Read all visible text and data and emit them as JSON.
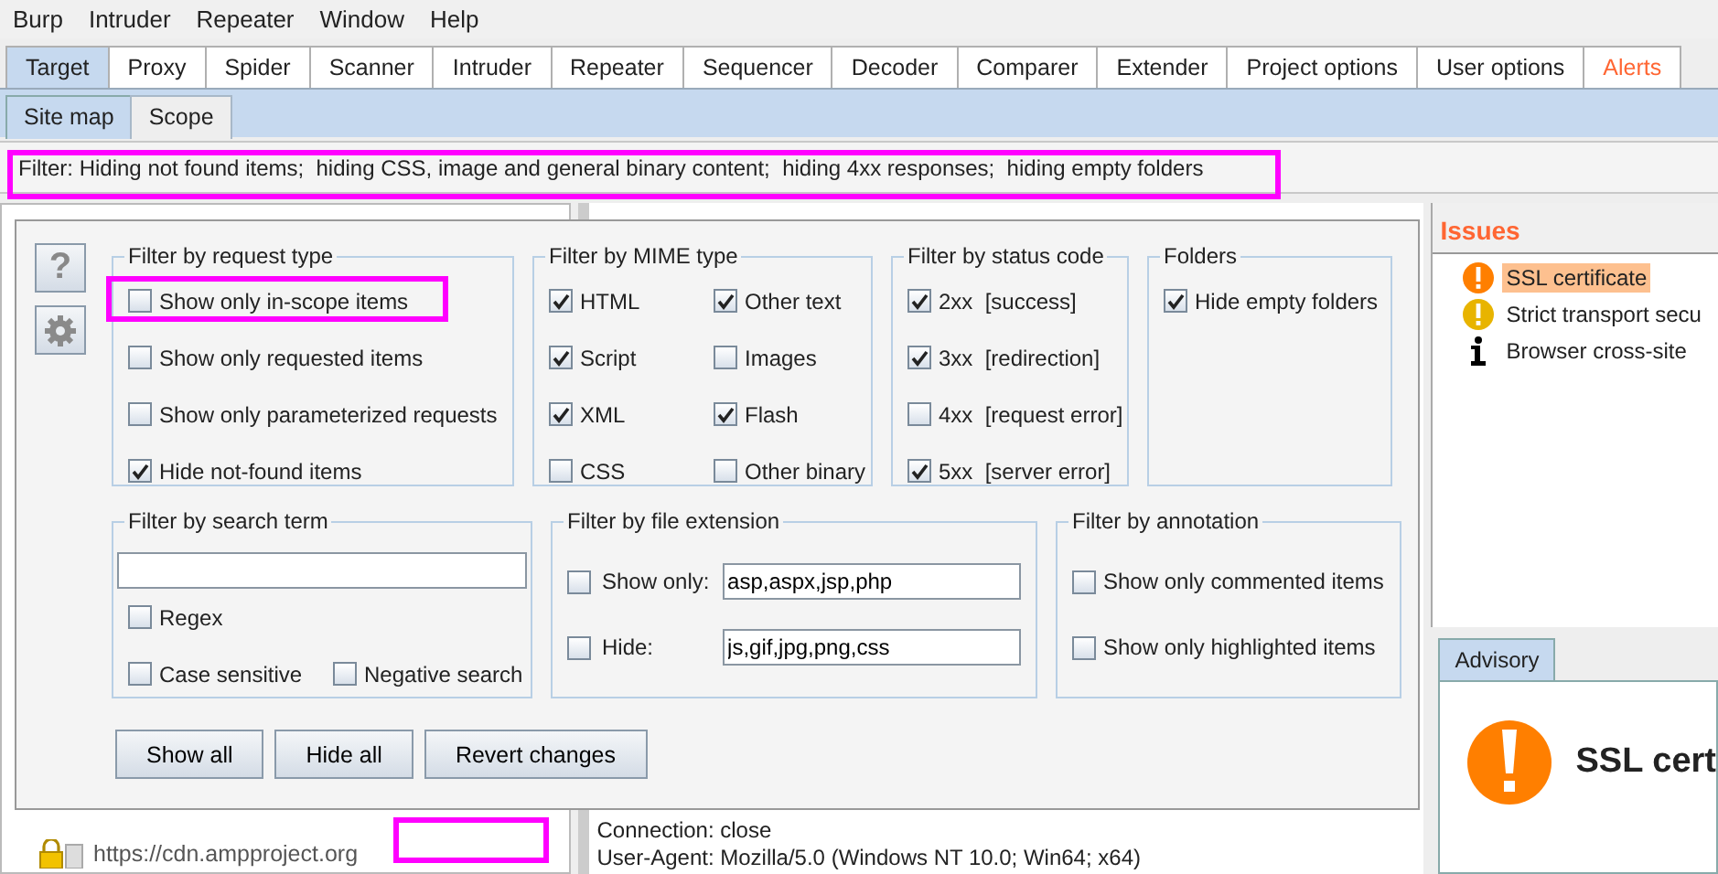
{
  "menu_bar": [
    "Burp",
    "Intruder",
    "Repeater",
    "Window",
    "Help"
  ],
  "tabs": [
    {
      "label": "Target",
      "selected": true,
      "alert": false
    },
    {
      "label": "Proxy",
      "selected": false,
      "alert": false
    },
    {
      "label": "Spider",
      "selected": false,
      "alert": false
    },
    {
      "label": "Scanner",
      "selected": false,
      "alert": false
    },
    {
      "label": "Intruder",
      "selected": false,
      "alert": false
    },
    {
      "label": "Repeater",
      "selected": false,
      "alert": false
    },
    {
      "label": "Sequencer",
      "selected": false,
      "alert": false
    },
    {
      "label": "Decoder",
      "selected": false,
      "alert": false
    },
    {
      "label": "Comparer",
      "selected": false,
      "alert": false
    },
    {
      "label": "Extender",
      "selected": false,
      "alert": false
    },
    {
      "label": "Project options",
      "selected": false,
      "alert": false
    },
    {
      "label": "User options",
      "selected": false,
      "alert": false
    },
    {
      "label": "Alerts",
      "selected": false,
      "alert": true
    }
  ],
  "sub_tabs": [
    {
      "label": "Site map",
      "selected": true
    },
    {
      "label": "Scope",
      "selected": false
    }
  ],
  "filter_bar": {
    "text": "Filter: Hiding not found items;  hiding CSS, image and general binary content;  hiding 4xx responses;  hiding empty folders"
  },
  "filter_popup": {
    "help_button": "?",
    "request_type": {
      "title": "Filter by request type",
      "options": [
        {
          "label": "Show only in-scope items",
          "checked": false
        },
        {
          "label": "Show only requested items",
          "checked": false
        },
        {
          "label": "Show only parameterized requests",
          "checked": false
        },
        {
          "label": "Hide not-found items",
          "checked": true
        }
      ]
    },
    "mime_type": {
      "title": "Filter by MIME type",
      "options": [
        {
          "label": "HTML",
          "checked": true
        },
        {
          "label": "Other text",
          "checked": true
        },
        {
          "label": "Script",
          "checked": true
        },
        {
          "label": "Images",
          "checked": false
        },
        {
          "label": "XML",
          "checked": true
        },
        {
          "label": "Flash",
          "checked": true
        },
        {
          "label": "CSS",
          "checked": false
        },
        {
          "label": "Other binary",
          "checked": false
        }
      ]
    },
    "status_code": {
      "title": "Filter by status code",
      "options": [
        {
          "label": "2xx  [success]",
          "checked": true
        },
        {
          "label": "3xx  [redirection]",
          "checked": true
        },
        {
          "label": "4xx  [request error]",
          "checked": false
        },
        {
          "label": "5xx  [server error]",
          "checked": true
        }
      ]
    },
    "folders": {
      "title": "Folders",
      "options": [
        {
          "label": "Hide empty folders",
          "checked": true
        }
      ]
    },
    "search_term": {
      "title": "Filter by search term",
      "options": [
        {
          "label": "Regex",
          "checked": false
        },
        {
          "label": "Case sensitive",
          "checked": false
        },
        {
          "label": "Negative search",
          "checked": false
        }
      ]
    },
    "file_extension": {
      "title": "Filter by file extension",
      "rows": [
        {
          "label": "Show only:",
          "checked": false,
          "value": "asp,aspx,jsp,php"
        },
        {
          "label": "Hide:",
          "checked": false,
          "value": "js,gif,jpg,png,css"
        }
      ]
    },
    "annotation": {
      "title": "Filter by annotation",
      "options": [
        {
          "label": "Show only commented items",
          "checked": false
        },
        {
          "label": "Show only highlighted items",
          "checked": false
        }
      ]
    },
    "buttons": [
      "Show all",
      "Hide all",
      "Revert changes"
    ]
  },
  "site_map": {
    "rows": [
      {
        "url": "https://cdn.ampproject.org"
      }
    ]
  },
  "request_view": {
    "lines": [
      "Connection: close",
      "User-Agent: Mozilla/5.0 (Windows NT 10.0; Win64; x64)"
    ]
  },
  "issues": {
    "title": "Issues",
    "items": [
      {
        "label": "SSL certificate",
        "kind": "high",
        "selected": true
      },
      {
        "label": "Strict transport secu",
        "kind": "medium",
        "selected": false
      },
      {
        "label": "Browser cross-site",
        "kind": "info",
        "selected": false
      }
    ]
  },
  "advisory": {
    "tabs": [
      {
        "label": "Advisory",
        "selected": true
      }
    ],
    "heading": "SSL cert",
    "kind": "high"
  }
}
